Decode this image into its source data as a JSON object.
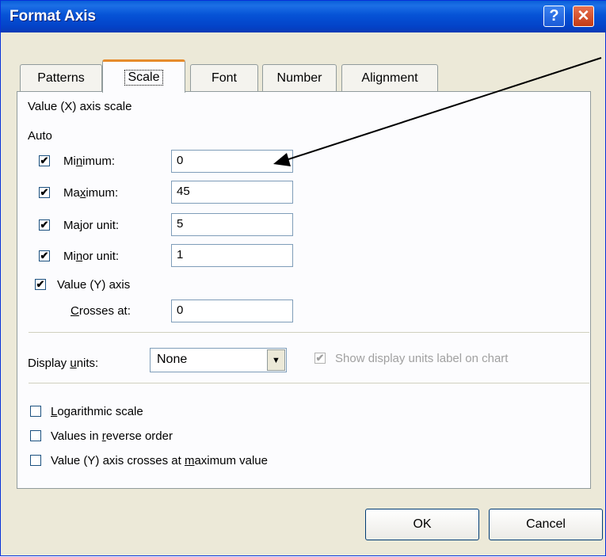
{
  "window": {
    "title": "Format Axis",
    "help_label": "?",
    "close_label": "✕"
  },
  "tabs": [
    {
      "label": "Patterns",
      "active": false
    },
    {
      "label": "Scale",
      "active": true
    },
    {
      "label": "Font",
      "active": false
    },
    {
      "label": "Number",
      "active": false
    },
    {
      "label": "Alignment",
      "active": false
    }
  ],
  "scale": {
    "heading": "Value (X) axis scale",
    "auto_label": "Auto",
    "minimum": {
      "label_pre": "Mi",
      "label_u": "n",
      "label_post": "imum:",
      "value": "0",
      "auto": true
    },
    "maximum": {
      "label_pre": "Ma",
      "label_u": "x",
      "label_post": "imum:",
      "value": "45",
      "auto": true
    },
    "major_unit": {
      "label_pre": "Ma",
      "label_u": "j",
      "label_post": "or unit:",
      "value": "5",
      "auto": true
    },
    "minor_unit": {
      "label_pre": "Mi",
      "label_u": "n",
      "label_post": "or unit:",
      "value": "1",
      "auto": true
    },
    "value_y_axis": {
      "label": "Value (Y) axis",
      "checked": true
    },
    "crosses_at": {
      "label_u": "C",
      "label_post": "rosses at:",
      "value": "0"
    }
  },
  "display_units": {
    "label_pre": "Display ",
    "label_u": "u",
    "label_post": "nits:",
    "selected": "None",
    "show_label": "Show display units label on chart",
    "show_label_checked": true
  },
  "options": {
    "logarithmic": {
      "label_u": "L",
      "label_post": "ogarithmic scale",
      "checked": false
    },
    "reverse": {
      "label_pre": "Values in ",
      "label_u": "r",
      "label_post": "everse order",
      "checked": false
    },
    "crosses_max": {
      "label_pre": "Value (Y) axis crosses at ",
      "label_u": "m",
      "label_post": "aximum value",
      "checked": false
    }
  },
  "buttons": {
    "ok": "OK",
    "cancel": "Cancel"
  },
  "check_glyph": "✔",
  "dropdown_glyph": "▼"
}
